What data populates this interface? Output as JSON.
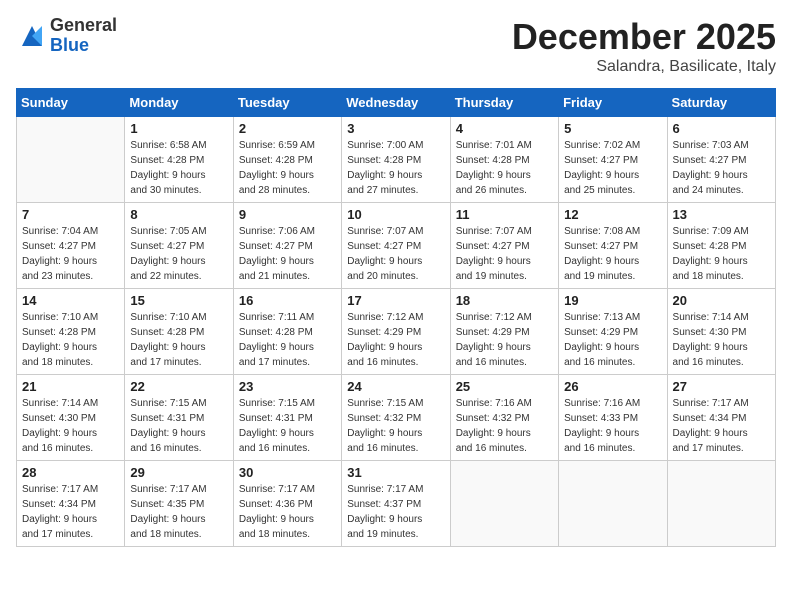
{
  "logo": {
    "general": "General",
    "blue": "Blue"
  },
  "title": "December 2025",
  "subtitle": "Salandra, Basilicate, Italy",
  "weekdays": [
    "Sunday",
    "Monday",
    "Tuesday",
    "Wednesday",
    "Thursday",
    "Friday",
    "Saturday"
  ],
  "weeks": [
    [
      {
        "day": "",
        "info": ""
      },
      {
        "day": "1",
        "info": "Sunrise: 6:58 AM\nSunset: 4:28 PM\nDaylight: 9 hours\nand 30 minutes."
      },
      {
        "day": "2",
        "info": "Sunrise: 6:59 AM\nSunset: 4:28 PM\nDaylight: 9 hours\nand 28 minutes."
      },
      {
        "day": "3",
        "info": "Sunrise: 7:00 AM\nSunset: 4:28 PM\nDaylight: 9 hours\nand 27 minutes."
      },
      {
        "day": "4",
        "info": "Sunrise: 7:01 AM\nSunset: 4:28 PM\nDaylight: 9 hours\nand 26 minutes."
      },
      {
        "day": "5",
        "info": "Sunrise: 7:02 AM\nSunset: 4:27 PM\nDaylight: 9 hours\nand 25 minutes."
      },
      {
        "day": "6",
        "info": "Sunrise: 7:03 AM\nSunset: 4:27 PM\nDaylight: 9 hours\nand 24 minutes."
      }
    ],
    [
      {
        "day": "7",
        "info": "Sunrise: 7:04 AM\nSunset: 4:27 PM\nDaylight: 9 hours\nand 23 minutes."
      },
      {
        "day": "8",
        "info": "Sunrise: 7:05 AM\nSunset: 4:27 PM\nDaylight: 9 hours\nand 22 minutes."
      },
      {
        "day": "9",
        "info": "Sunrise: 7:06 AM\nSunset: 4:27 PM\nDaylight: 9 hours\nand 21 minutes."
      },
      {
        "day": "10",
        "info": "Sunrise: 7:07 AM\nSunset: 4:27 PM\nDaylight: 9 hours\nand 20 minutes."
      },
      {
        "day": "11",
        "info": "Sunrise: 7:07 AM\nSunset: 4:27 PM\nDaylight: 9 hours\nand 19 minutes."
      },
      {
        "day": "12",
        "info": "Sunrise: 7:08 AM\nSunset: 4:27 PM\nDaylight: 9 hours\nand 19 minutes."
      },
      {
        "day": "13",
        "info": "Sunrise: 7:09 AM\nSunset: 4:28 PM\nDaylight: 9 hours\nand 18 minutes."
      }
    ],
    [
      {
        "day": "14",
        "info": "Sunrise: 7:10 AM\nSunset: 4:28 PM\nDaylight: 9 hours\nand 18 minutes."
      },
      {
        "day": "15",
        "info": "Sunrise: 7:10 AM\nSunset: 4:28 PM\nDaylight: 9 hours\nand 17 minutes."
      },
      {
        "day": "16",
        "info": "Sunrise: 7:11 AM\nSunset: 4:28 PM\nDaylight: 9 hours\nand 17 minutes."
      },
      {
        "day": "17",
        "info": "Sunrise: 7:12 AM\nSunset: 4:29 PM\nDaylight: 9 hours\nand 16 minutes."
      },
      {
        "day": "18",
        "info": "Sunrise: 7:12 AM\nSunset: 4:29 PM\nDaylight: 9 hours\nand 16 minutes."
      },
      {
        "day": "19",
        "info": "Sunrise: 7:13 AM\nSunset: 4:29 PM\nDaylight: 9 hours\nand 16 minutes."
      },
      {
        "day": "20",
        "info": "Sunrise: 7:14 AM\nSunset: 4:30 PM\nDaylight: 9 hours\nand 16 minutes."
      }
    ],
    [
      {
        "day": "21",
        "info": "Sunrise: 7:14 AM\nSunset: 4:30 PM\nDaylight: 9 hours\nand 16 minutes."
      },
      {
        "day": "22",
        "info": "Sunrise: 7:15 AM\nSunset: 4:31 PM\nDaylight: 9 hours\nand 16 minutes."
      },
      {
        "day": "23",
        "info": "Sunrise: 7:15 AM\nSunset: 4:31 PM\nDaylight: 9 hours\nand 16 minutes."
      },
      {
        "day": "24",
        "info": "Sunrise: 7:15 AM\nSunset: 4:32 PM\nDaylight: 9 hours\nand 16 minutes."
      },
      {
        "day": "25",
        "info": "Sunrise: 7:16 AM\nSunset: 4:32 PM\nDaylight: 9 hours\nand 16 minutes."
      },
      {
        "day": "26",
        "info": "Sunrise: 7:16 AM\nSunset: 4:33 PM\nDaylight: 9 hours\nand 16 minutes."
      },
      {
        "day": "27",
        "info": "Sunrise: 7:17 AM\nSunset: 4:34 PM\nDaylight: 9 hours\nand 17 minutes."
      }
    ],
    [
      {
        "day": "28",
        "info": "Sunrise: 7:17 AM\nSunset: 4:34 PM\nDaylight: 9 hours\nand 17 minutes."
      },
      {
        "day": "29",
        "info": "Sunrise: 7:17 AM\nSunset: 4:35 PM\nDaylight: 9 hours\nand 18 minutes."
      },
      {
        "day": "30",
        "info": "Sunrise: 7:17 AM\nSunset: 4:36 PM\nDaylight: 9 hours\nand 18 minutes."
      },
      {
        "day": "31",
        "info": "Sunrise: 7:17 AM\nSunset: 4:37 PM\nDaylight: 9 hours\nand 19 minutes."
      },
      {
        "day": "",
        "info": ""
      },
      {
        "day": "",
        "info": ""
      },
      {
        "day": "",
        "info": ""
      }
    ]
  ]
}
